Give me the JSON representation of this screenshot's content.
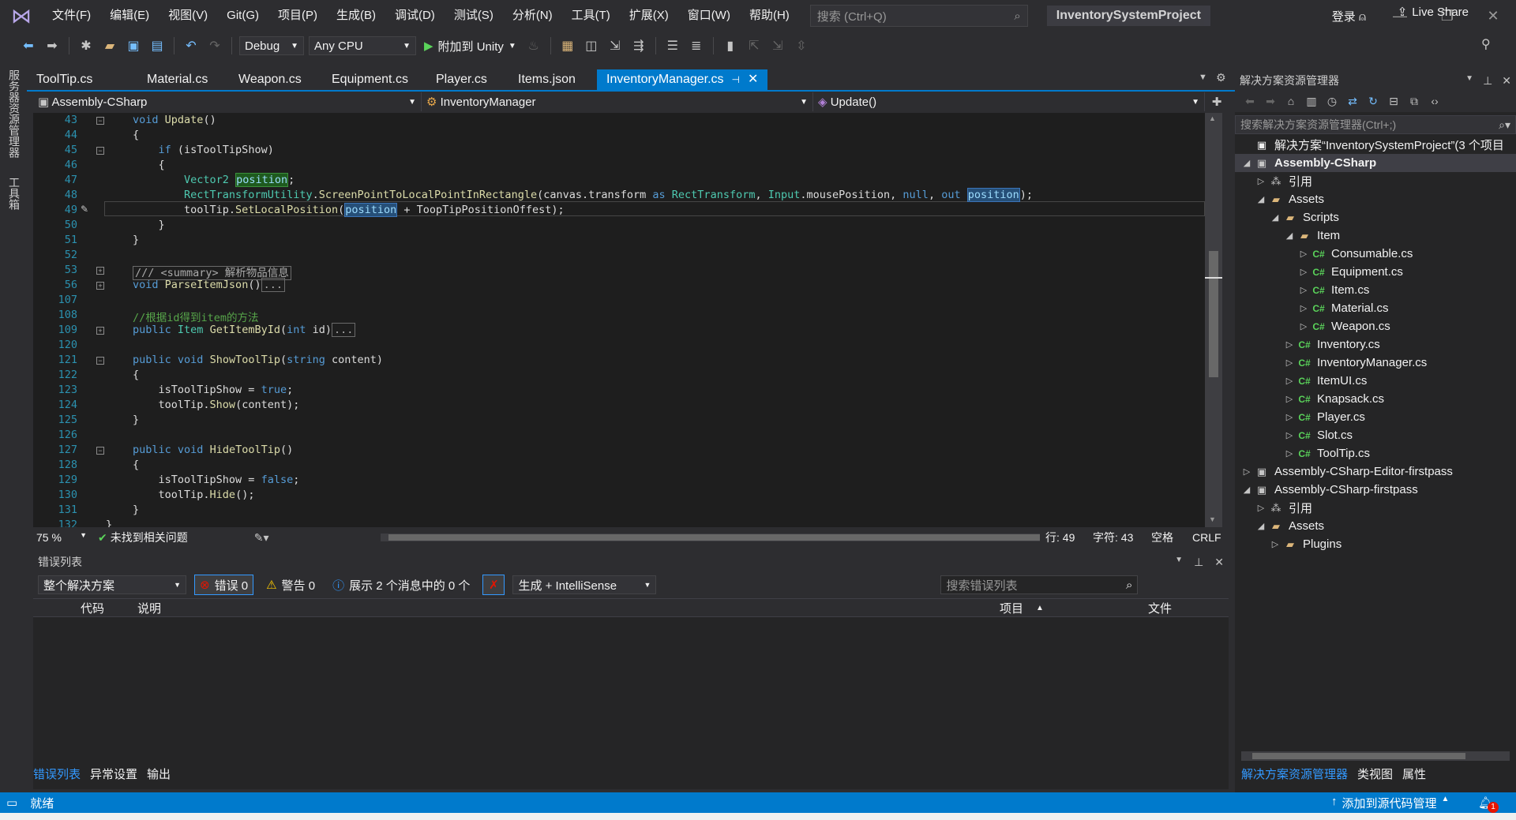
{
  "menu": [
    "文件(F)",
    "编辑(E)",
    "视图(V)",
    "Git(G)",
    "项目(P)",
    "生成(B)",
    "调试(D)",
    "测试(S)",
    "分析(N)",
    "工具(T)",
    "扩展(X)",
    "窗口(W)",
    "帮助(H)"
  ],
  "search": {
    "placeholder": "搜索 (Ctrl+Q)"
  },
  "project_name": "InventorySystemProject",
  "login": "登录",
  "toolbar": {
    "config": "Debug",
    "platform": "Any CPU",
    "run_label": "附加到 Unity",
    "liveshare": "Live Share"
  },
  "left_tabs": [
    "服务器资源管理器",
    "工具箱"
  ],
  "doc_tabs": [
    "ToolTip.cs",
    "Material.cs",
    "Weapon.cs",
    "Equipment.cs",
    "Player.cs",
    "Items.json",
    "InventoryManager.cs"
  ],
  "nav": {
    "project": "Assembly-CSharp",
    "class": "InventoryManager",
    "member": "Update()"
  },
  "line_numbers": [
    "43",
    "44",
    "45",
    "46",
    "47",
    "48",
    "49",
    "50",
    "51",
    "52",
    "53",
    "56",
    "107",
    "108",
    "109",
    "120",
    "121",
    "122",
    "123",
    "124",
    "125",
    "126",
    "127",
    "128",
    "129",
    "130",
    "131",
    "132"
  ],
  "editor_status": {
    "zoom": "75 %",
    "issues": "未找到相关问题",
    "line": "行: 49",
    "col": "字符: 43",
    "spaces": "空格",
    "eol": "CRLF"
  },
  "error_panel": {
    "title": "错误列表",
    "scope": "整个解决方案",
    "errors": "错误 0",
    "warnings": "警告 0",
    "messages": "展示 2 个消息中的 0 个",
    "build_filter": "生成 + IntelliSense",
    "search_placeholder": "搜索错误列表",
    "columns": {
      "code": "代码",
      "desc": "说明",
      "project": "项目",
      "file": "文件"
    }
  },
  "bottom_tabs": [
    "错误列表",
    "异常设置",
    "输出"
  ],
  "solution": {
    "title": "解决方案资源管理器",
    "search_placeholder": "搜索解决方案资源管理器(Ctrl+;)",
    "tree": [
      {
        "label": "解决方案“InventorySystemProject”(3 个项目",
        "icon": "solution",
        "level": 0,
        "arrow": ""
      },
      {
        "label": "Assembly-CSharp",
        "icon": "proj",
        "level": 0,
        "arrow": "◢",
        "bold": true,
        "selected": true
      },
      {
        "label": "引用",
        "icon": "ref",
        "level": 1,
        "arrow": "▷"
      },
      {
        "label": "Assets",
        "icon": "folder",
        "level": 1,
        "arrow": "◢"
      },
      {
        "label": "Scripts",
        "icon": "folder",
        "level": 2,
        "arrow": "◢"
      },
      {
        "label": "Item",
        "icon": "folder",
        "level": 3,
        "arrow": "◢"
      },
      {
        "label": "Consumable.cs",
        "icon": "cs",
        "level": 4,
        "arrow": "▷"
      },
      {
        "label": "Equipment.cs",
        "icon": "cs",
        "level": 4,
        "arrow": "▷"
      },
      {
        "label": "Item.cs",
        "icon": "cs",
        "level": 4,
        "arrow": "▷"
      },
      {
        "label": "Material.cs",
        "icon": "cs",
        "level": 4,
        "arrow": "▷"
      },
      {
        "label": "Weapon.cs",
        "icon": "cs",
        "level": 4,
        "arrow": "▷"
      },
      {
        "label": "Inventory.cs",
        "icon": "cs",
        "level": 3,
        "arrow": "▷"
      },
      {
        "label": "InventoryManager.cs",
        "icon": "cs",
        "level": 3,
        "arrow": "▷"
      },
      {
        "label": "ItemUI.cs",
        "icon": "cs",
        "level": 3,
        "arrow": "▷"
      },
      {
        "label": "Knapsack.cs",
        "icon": "cs",
        "level": 3,
        "arrow": "▷"
      },
      {
        "label": "Player.cs",
        "icon": "cs",
        "level": 3,
        "arrow": "▷"
      },
      {
        "label": "Slot.cs",
        "icon": "cs",
        "level": 3,
        "arrow": "▷"
      },
      {
        "label": "ToolTip.cs",
        "icon": "cs",
        "level": 3,
        "arrow": "▷"
      },
      {
        "label": "Assembly-CSharp-Editor-firstpass",
        "icon": "proj",
        "level": 0,
        "arrow": "▷"
      },
      {
        "label": "Assembly-CSharp-firstpass",
        "icon": "proj",
        "level": 0,
        "arrow": "◢"
      },
      {
        "label": "引用",
        "icon": "ref",
        "level": 1,
        "arrow": "▷"
      },
      {
        "label": "Assets",
        "icon": "folder",
        "level": 1,
        "arrow": "◢"
      },
      {
        "label": "Plugins",
        "icon": "folder",
        "level": 2,
        "arrow": "▷"
      }
    ],
    "bottom_tabs": [
      "解决方案资源管理器",
      "类视图",
      "属性"
    ]
  },
  "statusbar": {
    "ready": "就绪",
    "source_control": "添加到源代码管理",
    "notif_count": "1"
  },
  "colors": {
    "accent": "#007acc",
    "editor_bg": "#1e1e1e",
    "keyword": "#569cd6",
    "type": "#4ec9b0",
    "comment": "#57a64a",
    "line_number": "#2b91af"
  }
}
